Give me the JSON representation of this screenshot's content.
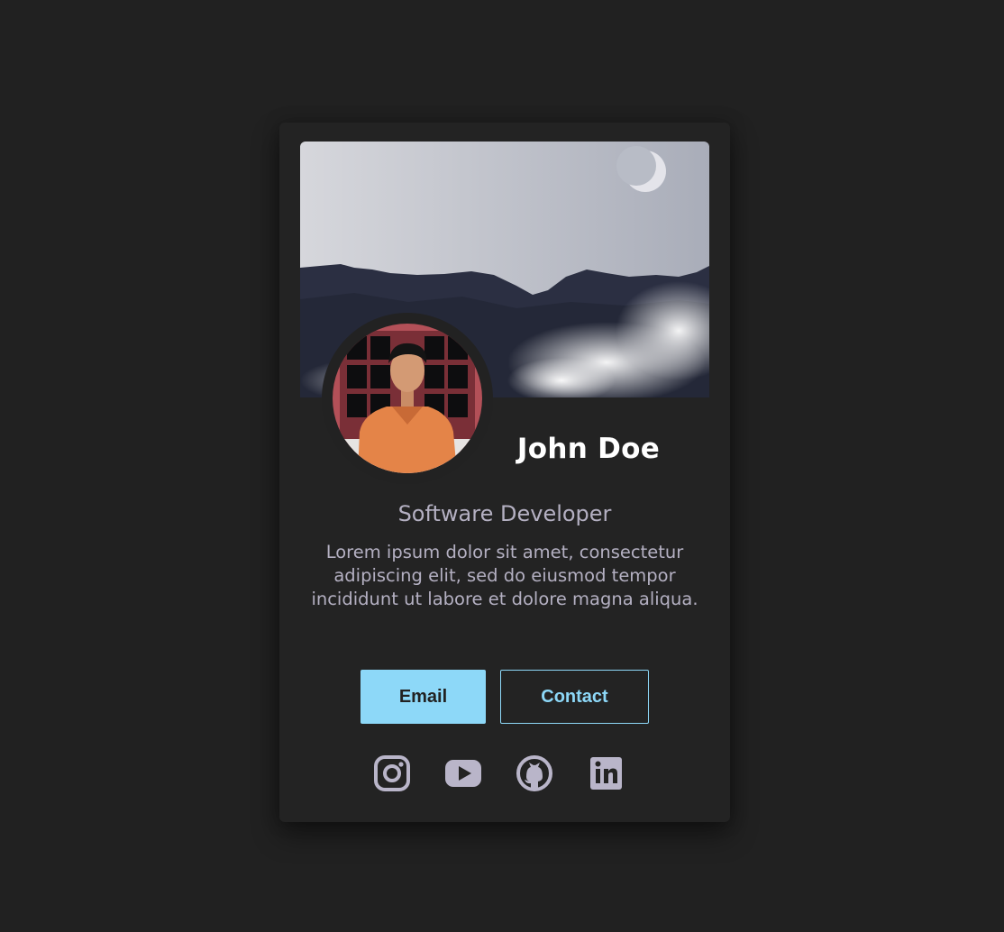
{
  "profile": {
    "name": "John Doe",
    "role": "Software Developer",
    "bio": "Lorem ipsum dolor sit amet, consectetur adipiscing elit, sed do eiusmod tempor incididunt ut labore et dolore magna aliqua."
  },
  "buttons": {
    "email_label": "Email",
    "contact_label": "Contact"
  },
  "socials": [
    "instagram-icon",
    "youtube-icon",
    "github-icon",
    "linkedin-icon"
  ],
  "colors": {
    "background": "#212121",
    "card": "#232323",
    "accent": "#8dd8f8",
    "text_primary": "#ffffff",
    "text_muted": "#b4b0c2",
    "icon": "#b9b5c9"
  }
}
